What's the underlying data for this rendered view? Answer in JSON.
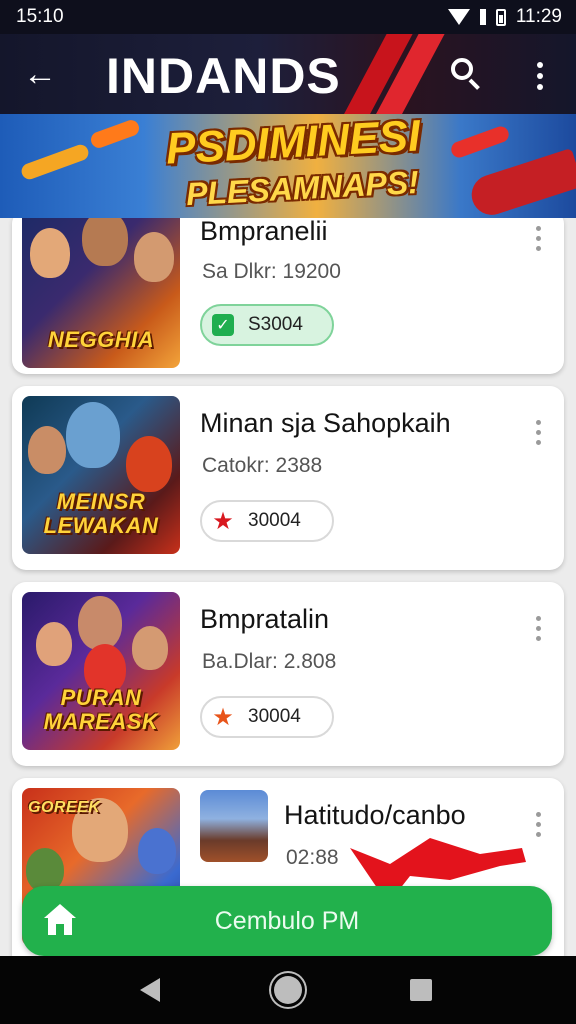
{
  "status_bar": {
    "time_left": "15:10",
    "time_right": "11:29"
  },
  "app_bar": {
    "title": "INDANDS"
  },
  "banner": {
    "title": "PSDIMINESI",
    "subtitle": "PLESAMNAPS!"
  },
  "games": [
    {
      "title": "Bmpranelii",
      "meta": "Sa Dlkr: 19200",
      "badge": "S3004",
      "badge_icon": "check-icon",
      "badge_style": "green",
      "thumb_logo": "NEGGHIA"
    },
    {
      "title": "Minan sja Sahopkaih",
      "meta": "Catokr: 2388",
      "badge": "30004",
      "badge_icon": "red-star-icon",
      "badge_style": "outline",
      "thumb_logo": "MEINSR LEWAKAN"
    },
    {
      "title": "Bmpratalin",
      "meta": "Ba.Dlar: 2.808",
      "badge": "30004",
      "badge_icon": "orange-star-icon",
      "badge_style": "outline",
      "thumb_logo": "PURAN MAREASK"
    },
    {
      "title": "Hatitudo/canbo",
      "meta": "02:88",
      "thumb_logo": "GOREEK"
    }
  ],
  "cta": {
    "label": "Cembulo PM"
  },
  "colors": {
    "cta_green": "#22b14c",
    "chip_green_bg": "#d8f3e0",
    "star_red": "#d8181f",
    "star_orange": "#e8541a",
    "app_bar_bg": "#14162b"
  }
}
